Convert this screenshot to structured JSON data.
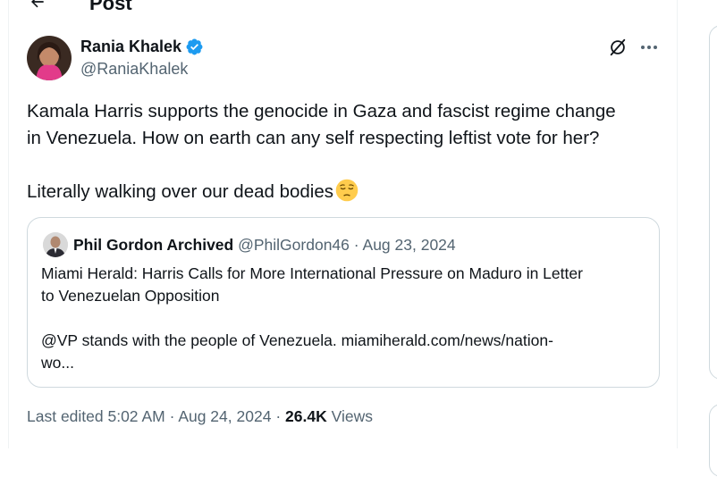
{
  "header": {
    "title": "Post"
  },
  "tweet": {
    "author_name": "Rania Khalek",
    "author_handle": "@RaniaKhalek",
    "text": "Kamala Harris supports the genocide in Gaza and fascist regime change\nin Venezuela. How on earth can any self respecting leftist vote for her?\n\nLiterally walking over our dead bodies",
    "emoji": "pensive-face"
  },
  "quote": {
    "author_name": "Phil Gordon Archived",
    "author_handle": "@PhilGordon46",
    "separator": "·",
    "date": "Aug 23, 2024",
    "text": "Miami Herald: Harris Calls for More International Pressure on Maduro in Letter\nto Venezuelan Opposition\n\n@VP stands with the people of Venezuela. miamiherald.com/news/nation-\nwo..."
  },
  "footer": {
    "edited_label": "Last edited 5:02 AM",
    "separator": "·",
    "date": "Aug 24, 2024",
    "views_count": "26.4K",
    "views_label": "Views"
  },
  "colors": {
    "verified": "#1d9bf0",
    "secondary_text": "#536471",
    "border": "#cfd9de"
  },
  "icons": [
    "back-arrow-icon",
    "verified-badge-icon",
    "grok-icon",
    "more-icon",
    "pensive-face-emoji"
  ]
}
